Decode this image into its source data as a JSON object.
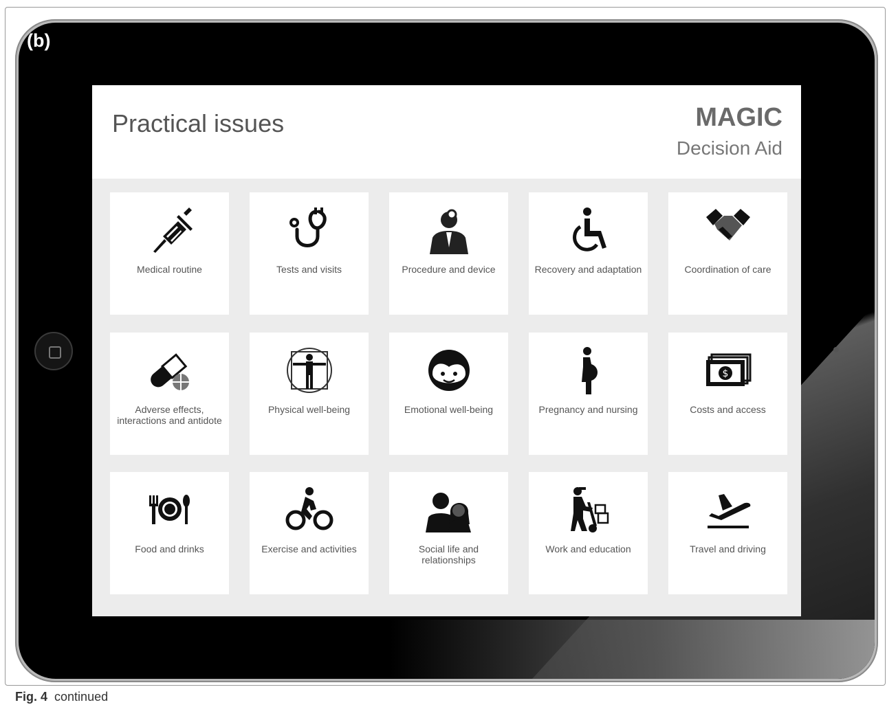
{
  "figure": {
    "panel_label": "(b)",
    "caption_prefix": "Fig. 4",
    "caption_text": "continued"
  },
  "header": {
    "title": "Practical issues",
    "brand": "MAGIC",
    "brand_subtitle": "Decision Aid"
  },
  "tiles": [
    {
      "label": "Medical routine",
      "icon": "syringe-icon"
    },
    {
      "label": "Tests and visits",
      "icon": "stethoscope-icon"
    },
    {
      "label": "Procedure and device",
      "icon": "doctor-icon"
    },
    {
      "label": "Recovery and adaptation",
      "icon": "wheelchair-icon"
    },
    {
      "label": "Coordination of care",
      "icon": "handshake-icon"
    },
    {
      "label": "Adverse effects, interactions and antidote",
      "icon": "pills-icon"
    },
    {
      "label": "Physical well-being",
      "icon": "vitruvian-man-icon"
    },
    {
      "label": "Emotional well-being",
      "icon": "smiley-face-icon"
    },
    {
      "label": "Pregnancy and nursing",
      "icon": "pregnant-woman-icon"
    },
    {
      "label": "Costs and access",
      "icon": "money-icon"
    },
    {
      "label": "Food and drinks",
      "icon": "plate-cutlery-icon"
    },
    {
      "label": "Exercise and activities",
      "icon": "cyclist-icon"
    },
    {
      "label": "Social life and relationships",
      "icon": "two-people-icon"
    },
    {
      "label": "Work and education",
      "icon": "hand-truck-icon"
    },
    {
      "label": "Travel and driving",
      "icon": "airplane-takeoff-icon"
    }
  ]
}
